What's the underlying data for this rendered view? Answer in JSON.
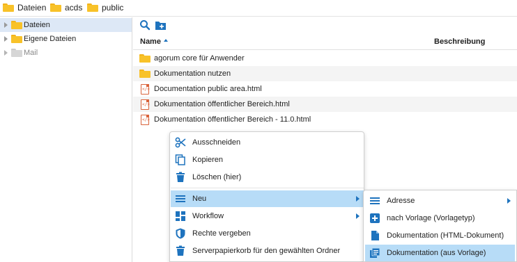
{
  "breadcrumb": {
    "items": [
      {
        "label": "Dateien",
        "icon": "folder-icon"
      },
      {
        "label": "acds",
        "icon": "folder-icon"
      },
      {
        "label": "public",
        "icon": "folder-icon"
      }
    ]
  },
  "tree": {
    "items": [
      {
        "label": "Dateien",
        "selected": true
      },
      {
        "label": "Eigene Dateien",
        "selected": false
      },
      {
        "label": "Mail",
        "selected": false
      }
    ]
  },
  "toolbar": {
    "search_icon": "search-icon",
    "new_folder_icon": "new-folder-icon"
  },
  "table": {
    "columns": [
      "Name",
      "Beschreibung"
    ],
    "sort_column": "Name",
    "sort_direction": "ascending",
    "rows": [
      {
        "name": "agorum core für Anwender",
        "type": "folder",
        "description": ""
      },
      {
        "name": "Dokumentation nutzen",
        "type": "folder",
        "description": ""
      },
      {
        "name": "Documentation public area.html",
        "type": "html",
        "description": ""
      },
      {
        "name": "Dokumentation öffentlicher Bereich.html",
        "type": "html",
        "description": ""
      },
      {
        "name": "Dokumentation öffentlicher Bereich - 11.0.html",
        "type": "html",
        "description": ""
      }
    ]
  },
  "context_menu": {
    "items": [
      {
        "label": "Ausschneiden",
        "icon": "scissors-icon"
      },
      {
        "label": "Kopieren",
        "icon": "copy-icon"
      },
      {
        "label": "Löschen (hier)",
        "icon": "trash-icon"
      },
      {
        "label": "Neu",
        "icon": "menu-lines-icon",
        "has_submenu": true,
        "highlighted": true
      },
      {
        "label": "Workflow",
        "icon": "workflow-grid-icon",
        "has_submenu": true
      },
      {
        "label": "Rechte vergeben",
        "icon": "shield-icon"
      },
      {
        "label": "Serverpapierkorb für den gewählten Ordner",
        "icon": "trash-icon"
      }
    ]
  },
  "submenu": {
    "items": [
      {
        "label": "Adresse",
        "icon": "menu-lines-icon",
        "has_submenu": true
      },
      {
        "label": "nach Vorlage (Vorlagetyp)",
        "icon": "plus-box-icon"
      },
      {
        "label": "Dokumentation (HTML-Dokument)",
        "icon": "document-icon"
      },
      {
        "label": "Dokumentation (aus Vorlage)",
        "icon": "document-stack-icon",
        "highlighted": true
      }
    ]
  },
  "colors": {
    "accent": "#1e73be",
    "folder": "#f8c229",
    "selection": "#dde8f6",
    "menu_highlight": "#b7dcf7",
    "html_icon": "#d9623a"
  }
}
